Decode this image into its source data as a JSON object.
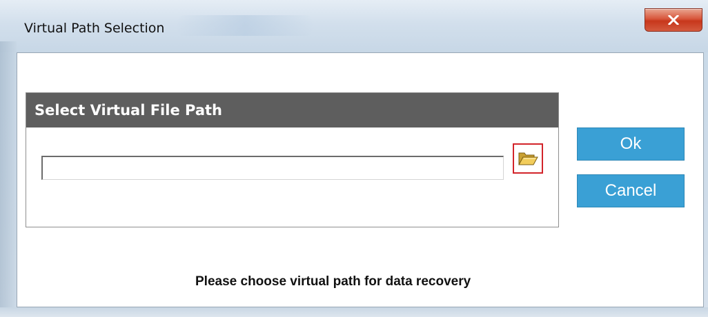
{
  "window": {
    "title": "Virtual Path Selection",
    "close_icon": "close-x-icon"
  },
  "group": {
    "header": "Select Virtual File Path",
    "path_value": "",
    "browse_icon": "folder-open-icon"
  },
  "buttons": {
    "ok_label": "Ok",
    "cancel_label": "Cancel"
  },
  "status": {
    "message": "Please choose virtual path for data recovery"
  },
  "colors": {
    "accent": "#3aa0d5",
    "header_bg": "#5e5e5e",
    "browse_border": "#d2232a"
  }
}
